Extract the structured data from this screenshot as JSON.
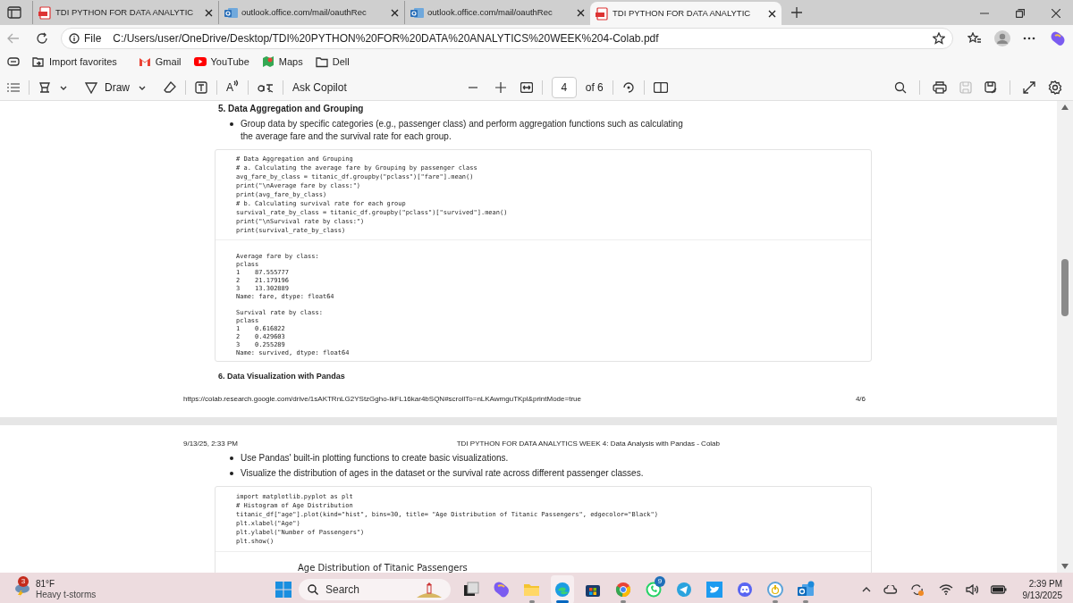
{
  "tabs": [
    {
      "kind": "pdf",
      "title": "TDI PYTHON FOR DATA ANALYTIC",
      "selected": false
    },
    {
      "kind": "outlook",
      "title": "outlook.office.com/mail/oauthRec",
      "selected": false
    },
    {
      "kind": "outlook",
      "title": "outlook.office.com/mail/oauthRec",
      "selected": false
    },
    {
      "kind": "pdf",
      "title": "TDI PYTHON FOR DATA ANALYTIC",
      "selected": true
    }
  ],
  "address_bar": {
    "scheme": "File",
    "url": "C:/Users/user/OneDrive/Desktop/TDI%20PYTHON%20FOR%20DATA%20ANALYTICS%20WEEK%204-Colab.pdf"
  },
  "favorites": [
    {
      "kind": "import",
      "label": "Import favorites"
    },
    {
      "kind": "gmail",
      "label": "Gmail"
    },
    {
      "kind": "youtube",
      "label": "YouTube"
    },
    {
      "kind": "maps",
      "label": "Maps"
    },
    {
      "kind": "folder",
      "label": "Dell"
    }
  ],
  "pdf_toolbar": {
    "draw": "Draw",
    "read_aloud": "A",
    "ask": "Ask Copilot",
    "page": "4",
    "page_count": "of 6"
  },
  "page_4": {
    "heading": "5. Data Aggregation and Grouping",
    "bullets": [
      "Group data by specific categories (e.g., passenger class) and perform aggregation functions such as calculating the average fare and the survival rate for each group."
    ],
    "code": "# Data Aggregation and Grouping\n# a. Calculating the average fare by Grouping by passenger class\navg_fare_by_class = titanic_df.groupby(\"pclass\")[\"fare\"].mean()\nprint(\"\\nAverage fare by class:\")\nprint(avg_fare_by_class)\n# b. Calculating survival rate for each group\nsurvival_rate_by_class = titanic_df.groupby(\"pclass\")[\"survived\"].mean()\nprint(\"\\nSurvival rate by class:\")\nprint(survival_rate_by_class)",
    "output": "Average fare by class:\npclass\n1    87.555777\n2    21.179196\n3    13.302889\nName: fare, dtype: float64\n\nSurvival rate by class:\npclass\n1    0.616822\n2    0.429603\n3    0.255289\nName: survived, dtype: float64",
    "heading_2": "6. Data Visualization with Pandas",
    "footer_url": "https://colab.research.google.com/drive/1sAKTRnLG2YStzGgho-IkFL16kar4bSQN#scrollTo=nLKAwmguTKpl&printMode=true",
    "footer_page": "4/6"
  },
  "page_5": {
    "header_date": "9/13/25, 2:33 PM",
    "header_title": "TDI PYTHON FOR DATA ANALYTICS WEEK 4: Data Analysis with Pandas - Colab",
    "bullets": [
      "Use Pandas' built-in plotting functions to create basic visualizations.",
      "Visualize the distribution of ages in the dataset or the survival rate across different passenger classes."
    ],
    "code": "import matplotlib.pyplot as plt\n# Histogram of Age Distribution\ntitanic_df[\"age\"].plot(kind=\"hist\", bins=30, title= \"Age Distribution of Titanic Passengers\", edgecolor=\"Black\")\nplt.xlabel(\"Age\")\nplt.ylabel(\"Number of Passengers\")\nplt.show()",
    "chart_title": "Age Distribution of Titanic Passengers"
  },
  "taskbar": {
    "weather_badge": "3",
    "temperature": "81°F",
    "condition": "Heavy t-storms",
    "search_placeholder": "Search",
    "apps": [
      {
        "kind": "taskview",
        "running": false,
        "active": false
      },
      {
        "kind": "copilot",
        "running": false,
        "active": false
      },
      {
        "kind": "explorer",
        "running": true,
        "active": false
      },
      {
        "kind": "edge",
        "running": true,
        "active": true
      },
      {
        "kind": "store",
        "running": false,
        "active": false
      },
      {
        "kind": "chrome",
        "running": true,
        "active": false
      },
      {
        "kind": "whatsapp",
        "running": false,
        "active": false,
        "badge": "9"
      },
      {
        "kind": "telegram",
        "running": false,
        "active": false
      },
      {
        "kind": "twitter",
        "running": false,
        "active": false
      },
      {
        "kind": "discord",
        "running": false,
        "active": false
      },
      {
        "kind": "ring",
        "running": true,
        "active": false
      },
      {
        "kind": "outlook",
        "running": true,
        "active": false
      }
    ],
    "time": "2:39 PM",
    "date": "9/13/2025"
  }
}
